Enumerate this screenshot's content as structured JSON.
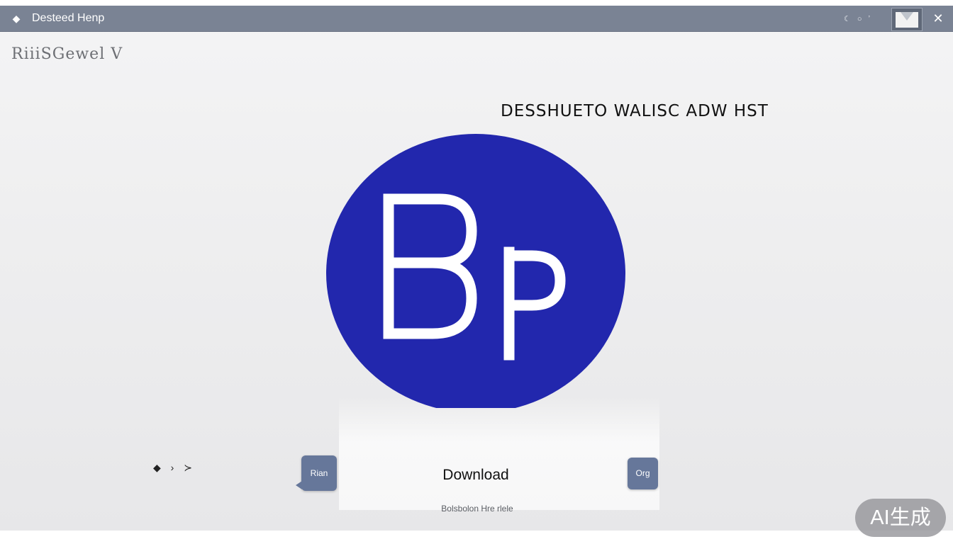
{
  "titlebar": {
    "title": "Desteed Henp",
    "misc_icons": "☾ ○ ʼ"
  },
  "brand": {
    "text": "RiiiSGewel V"
  },
  "headline": "DESSHUETO WALISC ADW HST",
  "logo": {
    "letters": "BP",
    "circle_color": "#2227ad",
    "letter_color": "#ffffff"
  },
  "controls": {
    "arrows": "◆ › ≻",
    "left_button": "Rian",
    "download": "Download",
    "right_button": "Org"
  },
  "footer_note": "Bolsbolon Hre rlele",
  "watermark": "AI生成",
  "colors": {
    "titlebar": "#7a8394",
    "button": "#66779a",
    "background": "#eeeeef"
  }
}
